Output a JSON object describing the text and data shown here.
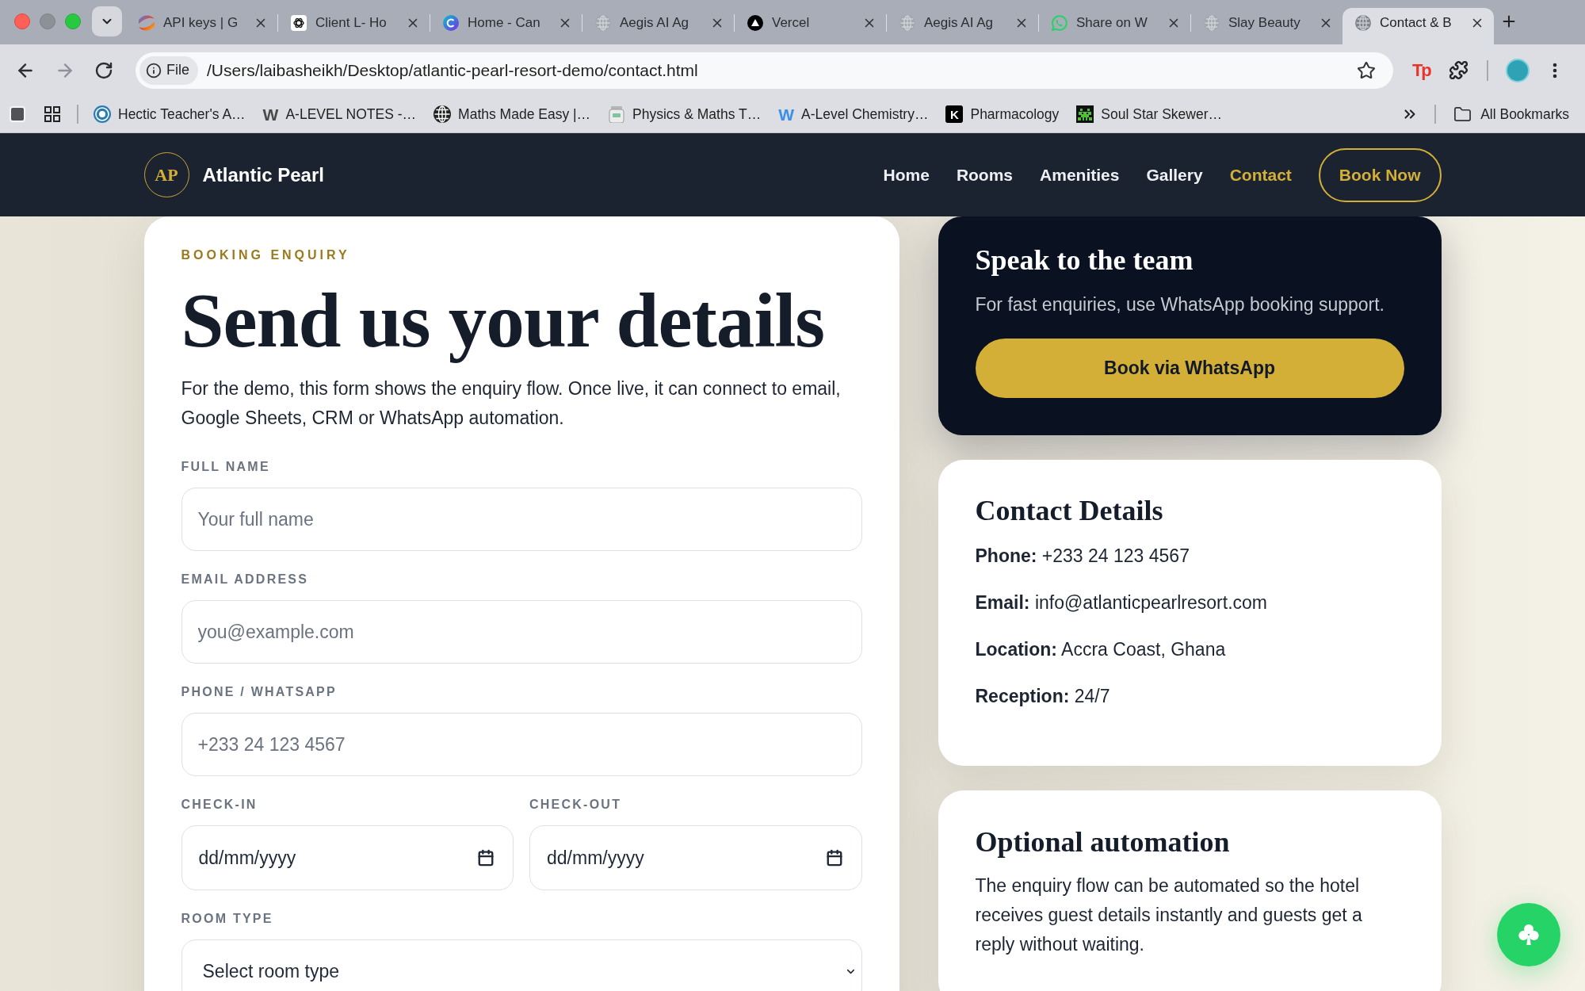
{
  "browser": {
    "tabs": [
      {
        "title": "API keys | G",
        "selected": false
      },
      {
        "title": "Client L- Ho",
        "selected": false
      },
      {
        "title": "Home - Can",
        "selected": false
      },
      {
        "title": "Aegis AI Ag",
        "selected": false
      },
      {
        "title": "Vercel",
        "selected": false
      },
      {
        "title": "Aegis AI Ag",
        "selected": false
      },
      {
        "title": "Share on W",
        "selected": false
      },
      {
        "title": "Slay Beauty",
        "selected": false
      },
      {
        "title": "Contact & B",
        "selected": true
      }
    ],
    "address_bar": {
      "scheme": "File",
      "url": "/Users/laibasheikh/Desktop/atlantic-pearl-resort-demo/contact.html"
    },
    "extension_badge": "Tp",
    "bookmarks": [
      {
        "label": "Hectic Teacher's A…"
      },
      {
        "label": "A-LEVEL NOTES -…",
        "favicon_text": "W"
      },
      {
        "label": "Maths Made Easy |…"
      },
      {
        "label": "Physics & Maths T…"
      },
      {
        "label": "A-Level Chemistry…",
        "favicon_text": "W"
      },
      {
        "label": "Pharmacology",
        "favicon_text": "K"
      },
      {
        "label": "Soul Star Skewer…"
      }
    ],
    "all_bookmarks": "All Bookmarks"
  },
  "site_header": {
    "logo_mark": "AP",
    "brand": "Atlantic Pearl",
    "nav": [
      {
        "label": "Home",
        "selected": false
      },
      {
        "label": "Rooms",
        "selected": false
      },
      {
        "label": "Amenities",
        "selected": false
      },
      {
        "label": "Gallery",
        "selected": false
      },
      {
        "label": "Contact",
        "selected": true
      }
    ],
    "cta": "Book Now"
  },
  "enquiry_form": {
    "eyebrow": "BOOKING ENQUIRY",
    "title": "Send us your details",
    "intro": "For the demo, this form shows the enquiry flow. Once live, it can connect to email, Google Sheets, CRM or WhatsApp automation.",
    "fields": [
      {
        "kind": "text",
        "label": "FULL NAME",
        "placeholder": "Your full name"
      },
      {
        "kind": "text",
        "label": "EMAIL ADDRESS",
        "placeholder": "you@example.com"
      },
      {
        "kind": "text",
        "label": "PHONE / WHATSAPP",
        "placeholder": "+233 24 123 4567"
      },
      {
        "kind": "date",
        "label": "CHECK-IN",
        "placeholder": "dd/mm/yyyy"
      },
      {
        "kind": "date",
        "label": "CHECK-OUT",
        "placeholder": "dd/mm/yyyy"
      },
      {
        "kind": "select",
        "label": "ROOM TYPE",
        "value": "Select room type"
      }
    ]
  },
  "whatsapp_card": {
    "title": "Speak to the team",
    "text": "For fast enquiries, use WhatsApp booking support.",
    "button": "Book via WhatsApp"
  },
  "contact_details": {
    "title": "Contact Details",
    "lines": [
      "**Phone:** +233 24 123 4567",
      "**Email:** info@atlanticpearlresort.com",
      "**Location:** Accra Coast, Ghana",
      "**Reception:** 24/7"
    ]
  },
  "automation_card": {
    "title": "Optional automation",
    "text": "The enquiry flow can be automated so the hotel receives guest details instantly and guests get a reply without waiting."
  }
}
